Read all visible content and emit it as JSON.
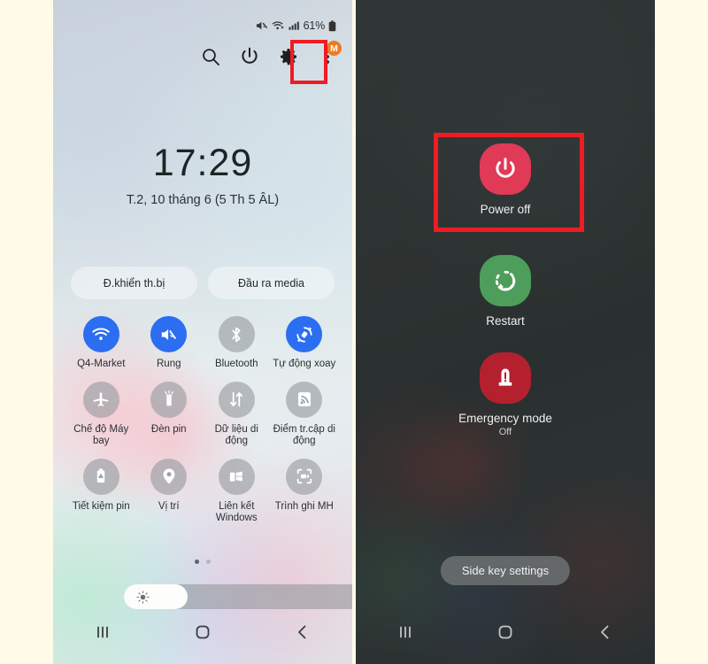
{
  "left_phone": {
    "status_bar": {
      "mute_icon": "volume-mute-icon",
      "wifi_icon": "wifi-plus-icon",
      "signal_icon": "cellular-signal-icon",
      "battery_percent": "61%",
      "battery_icon": "battery-icon"
    },
    "header": {
      "search_icon": "search-icon",
      "power_icon": "power-icon",
      "settings_icon": "gear-icon",
      "more_icon": "more-vertical-icon",
      "avatar_initial": "M",
      "highlight_color": "#ef1c24"
    },
    "clock": {
      "time": "17:29",
      "date": "T.2, 10 tháng 6 (5 Th 5 ÂL)"
    },
    "pills": [
      {
        "label": "Đ.khiển th.bị",
        "name": "device-control-pill"
      },
      {
        "label": "Đầu ra media",
        "name": "media-output-pill"
      }
    ],
    "quick_settings": [
      {
        "label": "Q4-Market",
        "icon": "wifi-icon",
        "state": "on",
        "name": "qs-tile-wifi"
      },
      {
        "label": "Rung",
        "icon": "vibrate-icon",
        "state": "on",
        "name": "qs-tile-vibrate"
      },
      {
        "label": "Bluetooth",
        "icon": "bluetooth-icon",
        "state": "off",
        "name": "qs-tile-bluetooth"
      },
      {
        "label": "Tự động xoay",
        "icon": "auto-rotate-icon",
        "state": "on",
        "name": "qs-tile-auto-rotate"
      },
      {
        "label": "Chế độ Máy bay",
        "icon": "airplane-icon",
        "state": "off",
        "name": "qs-tile-airplane-mode"
      },
      {
        "label": "Đèn pin",
        "icon": "flashlight-icon",
        "state": "off",
        "name": "qs-tile-flashlight"
      },
      {
        "label": "Dữ liệu di động",
        "icon": "mobile-data-icon",
        "state": "off",
        "name": "qs-tile-mobile-data"
      },
      {
        "label": "Điểm tr.cập di động",
        "icon": "hotspot-icon",
        "state": "off",
        "name": "qs-tile-hotspot"
      },
      {
        "label": "Tiết kiệm pin",
        "icon": "battery-saver-icon",
        "state": "off",
        "name": "qs-tile-power-saving"
      },
      {
        "label": "Vị trí",
        "icon": "location-pin-icon",
        "state": "off",
        "name": "qs-tile-location"
      },
      {
        "label": "Liên kết Windows",
        "icon": "link-to-windows-icon",
        "state": "off",
        "name": "qs-tile-link-windows"
      },
      {
        "label": "Trình ghi MH",
        "icon": "screen-recorder-icon",
        "state": "off",
        "name": "qs-tile-screen-recorder"
      }
    ],
    "pagination": {
      "pages": 2,
      "active": 1
    },
    "brightness": {
      "icon": "brightness-sun-icon",
      "value_percent": 24,
      "menu_icon": "more-vertical-icon"
    },
    "nav_bar": {
      "recents_icon": "recents-icon",
      "home_icon": "home-icon",
      "back_icon": "back-icon"
    }
  },
  "right_phone": {
    "power_menu": [
      {
        "label": "Power off",
        "sub": "",
        "icon": "power-icon",
        "color": "#e03a56",
        "name": "power-off-option"
      },
      {
        "label": "Restart",
        "sub": "",
        "icon": "restart-icon",
        "color": "#4c9e5a",
        "name": "restart-option"
      },
      {
        "label": "Emergency mode",
        "sub": "Off",
        "icon": "emergency-icon",
        "color": "#b4202e",
        "name": "emergency-mode-option"
      }
    ],
    "side_key_settings": "Side key settings",
    "highlight_color": "#ef1c24",
    "nav_bar": {
      "recents_icon": "recents-icon",
      "home_icon": "home-icon",
      "back_icon": "back-icon"
    }
  }
}
